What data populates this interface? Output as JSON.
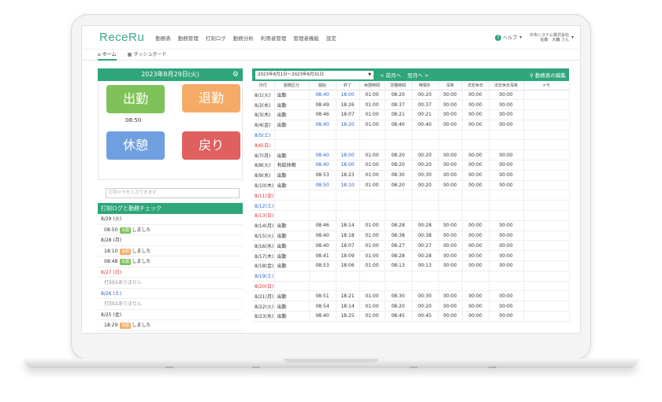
{
  "app": {
    "logo": "ReceRu",
    "nav": [
      "勤務表",
      "勤務管理",
      "打刻ログ",
      "勤務分析",
      "利用者管理",
      "管理者機能",
      "設定"
    ],
    "help": "ヘルプ",
    "user_company": "中央システム株式会社",
    "user_name": "佐藤　大輔 さん",
    "tabs": [
      "ホーム",
      "ダッシュボード"
    ]
  },
  "left": {
    "date": "2023年8月29日(火)",
    "buttons": [
      "出勤",
      "退勤",
      "休憩",
      "戻り"
    ],
    "clockin_time": "08:50",
    "memo_placeholder": "打刻メモを入力できます",
    "log_title": "打刻ログと勤務チェック"
  },
  "log": [
    {
      "text": "8/29 (火)",
      "type": "day"
    },
    {
      "time": "08:50",
      "badge": "出勤",
      "suffix": "しました",
      "badge_color": "green",
      "type": "entry"
    },
    {
      "text": "8/28 (月)",
      "type": "day"
    },
    {
      "time": "18:10",
      "badge": "退勤",
      "suffix": "しました",
      "badge_color": "orange",
      "type": "entry"
    },
    {
      "time": "08:48",
      "badge": "出勤",
      "suffix": "しました",
      "badge_color": "green",
      "type": "entry"
    },
    {
      "text": "8/27 (日)",
      "type": "day-red"
    },
    {
      "text": "打刻はありません",
      "type": "none"
    },
    {
      "text": "8/26 (土)",
      "type": "day-blue"
    },
    {
      "text": "打刻はありません",
      "type": "none"
    },
    {
      "text": "8/25 (金)",
      "type": "day"
    },
    {
      "time": "18:29",
      "badge": "退勤",
      "suffix": "しました",
      "badge_color": "orange",
      "type": "entry"
    }
  ],
  "right": {
    "range": "2023年8月1日～2023年8月31日",
    "prev": "< 前月へ",
    "next": "翌月へ >",
    "edit": "勤務表の編集",
    "columns": [
      "日付",
      "勤務区分",
      "開始",
      "終了",
      "休憩時間",
      "労働時間",
      "時間外",
      "深夜",
      "法定休日",
      "法定休日深夜",
      "メモ"
    ]
  },
  "rows": [
    {
      "date": "8/1(火)",
      "cat": "出勤",
      "start": "08:40",
      "end": "18:00",
      "brk": "01:00",
      "work": "08:20",
      "ot": "00:20",
      "night": "00:00",
      "hol": "00:00",
      "holn": "00:00",
      "blue": true
    },
    {
      "date": "8/2(水)",
      "cat": "出勤",
      "start": "08:49",
      "end": "18:26",
      "brk": "01:00",
      "work": "08:37",
      "ot": "00:37",
      "night": "00:00",
      "hol": "00:00",
      "holn": "00:00"
    },
    {
      "date": "8/3(木)",
      "cat": "出勤",
      "start": "08:46",
      "end": "18:07",
      "brk": "01:00",
      "work": "08:21",
      "ot": "00:21",
      "night": "00:00",
      "hol": "00:00",
      "holn": "00:00"
    },
    {
      "date": "8/4(金)",
      "cat": "出勤",
      "start": "08:40",
      "end": "18:20",
      "brk": "01:00",
      "work": "08:40",
      "ot": "00:40",
      "night": "00:00",
      "hol": "00:00",
      "holn": "00:00",
      "blue": true
    },
    {
      "date": "8/5(土)",
      "type": "sat"
    },
    {
      "date": "8/6(日)",
      "type": "sun"
    },
    {
      "date": "8/7(月)",
      "cat": "出勤",
      "start": "08:40",
      "end": "18:00",
      "brk": "01:00",
      "work": "08:20",
      "ot": "00:20",
      "night": "00:00",
      "hol": "00:00",
      "holn": "00:00",
      "blue": true
    },
    {
      "date": "8/8(火)",
      "cat": "有給休暇",
      "start": "08:40",
      "end": "18:00",
      "brk": "01:00",
      "work": "08:20",
      "ot": "00:20",
      "night": "00:00",
      "hol": "00:00",
      "holn": "00:00",
      "blue": true
    },
    {
      "date": "8/9(水)",
      "cat": "出勤",
      "start": "08:53",
      "end": "18:23",
      "brk": "01:00",
      "work": "08:30",
      "ot": "00:30",
      "night": "00:00",
      "hol": "00:00",
      "holn": "00:00"
    },
    {
      "date": "8/10(木)",
      "cat": "出勤",
      "start": "08:50",
      "end": "18:10",
      "brk": "01:00",
      "work": "08:20",
      "ot": "00:20",
      "night": "00:00",
      "hol": "00:00",
      "holn": "00:00",
      "blue": true
    },
    {
      "date": "8/11(金)",
      "type": "sun"
    },
    {
      "date": "8/12(土)",
      "type": "sat"
    },
    {
      "date": "8/13(日)",
      "type": "sun"
    },
    {
      "date": "8/14(月)",
      "cat": "出勤",
      "start": "08:46",
      "end": "18:14",
      "brk": "01:00",
      "work": "08:28",
      "ot": "00:28",
      "night": "00:00",
      "hol": "00:00",
      "holn": "00:00"
    },
    {
      "date": "8/15(火)",
      "cat": "出勤",
      "start": "08:40",
      "end": "18:18",
      "brk": "01:00",
      "work": "08:38",
      "ot": "00:38",
      "night": "00:00",
      "hol": "00:00",
      "holn": "00:00"
    },
    {
      "date": "8/16(水)",
      "cat": "出勤",
      "start": "08:40",
      "end": "18:07",
      "brk": "01:00",
      "work": "08:27",
      "ot": "00:27",
      "night": "00:00",
      "hol": "00:00",
      "holn": "00:00"
    },
    {
      "date": "8/17(木)",
      "cat": "出勤",
      "start": "08:41",
      "end": "18:09",
      "brk": "01:00",
      "work": "08:28",
      "ot": "00:28",
      "night": "00:00",
      "hol": "00:00",
      "holn": "00:00"
    },
    {
      "date": "8/18(金)",
      "cat": "出勤",
      "start": "08:53",
      "end": "18:06",
      "brk": "01:00",
      "work": "08:13",
      "ot": "00:13",
      "night": "00:00",
      "hol": "00:00",
      "holn": "00:00"
    },
    {
      "date": "8/19(土)",
      "type": "sat"
    },
    {
      "date": "8/20(日)",
      "type": "sun"
    },
    {
      "date": "8/21(月)",
      "cat": "出勤",
      "start": "08:51",
      "end": "18:21",
      "brk": "01:00",
      "work": "08:30",
      "ot": "00:30",
      "night": "00:00",
      "hol": "00:00",
      "holn": "00:00"
    },
    {
      "date": "8/22(火)",
      "cat": "出勤",
      "start": "08:54",
      "end": "18:14",
      "brk": "01:00",
      "work": "08:20",
      "ot": "00:20",
      "night": "00:00",
      "hol": "00:00",
      "holn": "00:00"
    },
    {
      "date": "8/23(水)",
      "cat": "出勤",
      "start": "08:40",
      "end": "18:25",
      "brk": "01:00",
      "work": "08:45",
      "ot": "00:45",
      "night": "00:00",
      "hol": "00:00",
      "holn": "00:00"
    }
  ],
  "colors": {
    "accent": "#2fa57a",
    "clockin": "#7fc25a",
    "clockout": "#f5ab66",
    "break": "#6f9fdf",
    "return": "#e0605f"
  }
}
